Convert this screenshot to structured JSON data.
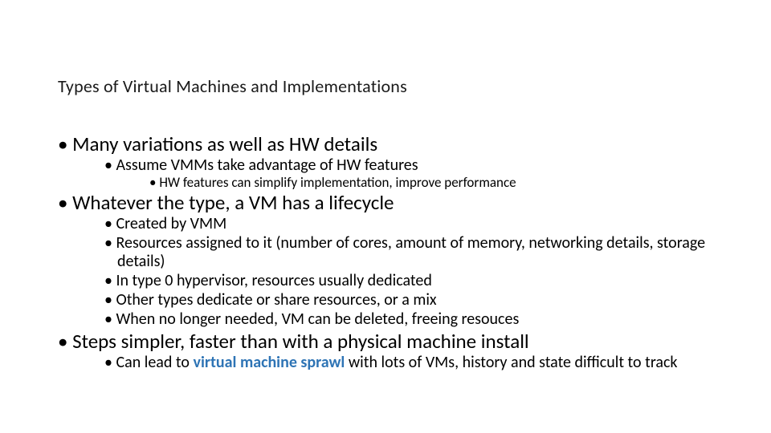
{
  "title": "Types of Virtual Machines and Implementations",
  "bullets": {
    "b1": "Many variations as well as HW details",
    "b1_1": "Assume VMMs take advantage of HW features",
    "b1_1_1": "HW features can simplify implementation, improve performance",
    "b2": "Whatever the type, a VM has a lifecycle",
    "b2_1": "Created by VMM",
    "b2_2": "Resources assigned to it (number of cores, amount of memory, networking details, storage details)",
    "b2_3": "In type 0 hypervisor, resources usually dedicated",
    "b2_4": "Other types dedicate or share resources, or a mix",
    "b2_5": "When no longer needed, VM can be deleted, freeing resouces",
    "b3": "Steps simpler, faster than with a physical machine install",
    "b3_1a": "Can lead to ",
    "b3_1_term": "virtual machine sprawl",
    "b3_1b": " with lots of VMs, history and state difficult to track"
  }
}
